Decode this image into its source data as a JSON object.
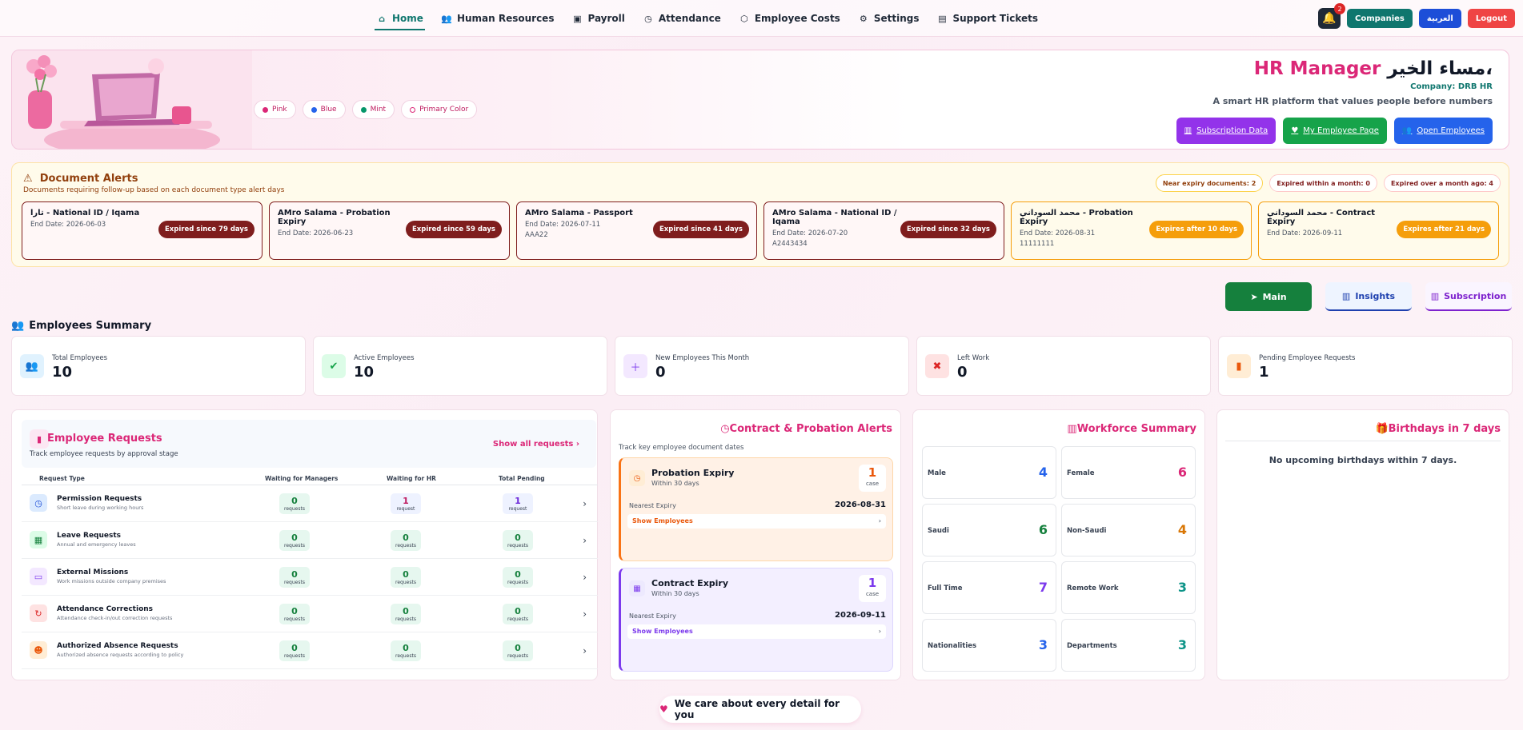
{
  "nav": {
    "items": [
      {
        "label": "Home",
        "icon": "home-icon"
      },
      {
        "label": "Human Resources",
        "icon": "people-icon"
      },
      {
        "label": "Payroll",
        "icon": "wallet-icon"
      },
      {
        "label": "Attendance",
        "icon": "clock-icon"
      },
      {
        "label": "Employee Costs",
        "icon": "box-icon"
      },
      {
        "label": "Settings",
        "icon": "gear-icon"
      },
      {
        "label": "Support Tickets",
        "icon": "ticket-icon"
      }
    ],
    "notification_count": "2",
    "companies": "Companies",
    "language": "العربية",
    "logout": "Logout"
  },
  "hero": {
    "greeting": "مساء الخير،",
    "role": "HR Manager",
    "company": "Company: DRB HR",
    "tagline": "A smart HR platform that values people before numbers",
    "themes": [
      {
        "label": "Pink",
        "color": "#db2777"
      },
      {
        "label": "Blue",
        "color": "#2563eb"
      },
      {
        "label": "Mint",
        "color": "#059669"
      },
      {
        "label": "Primary Color",
        "color": "#ffffff"
      }
    ],
    "buttons": {
      "subscription": "Subscription Data",
      "my_page": "My Employee Page",
      "open_employees": "Open Employees"
    }
  },
  "alerts": {
    "title": "Document Alerts",
    "subtitle": "Documents requiring follow-up based on each document type alert days",
    "pills": [
      "Near expiry documents: 2",
      "Expired within a month: 0",
      "Expired over a month ago: 4"
    ],
    "cards": [
      {
        "title": "تارا - National ID / Iqama",
        "end": "End Date: 2026-06-03",
        "extra": "",
        "badge": "Expired since 79 days",
        "warn": false
      },
      {
        "title": "AMro Salama - Probation Expiry",
        "end": "End Date: 2026-06-23",
        "extra": "",
        "badge": "Expired since 59 days",
        "warn": false
      },
      {
        "title": "AMro Salama - Passport",
        "end": "End Date: 2026-07-11",
        "extra": "AAA22",
        "badge": "Expired since 41 days",
        "warn": false
      },
      {
        "title": "AMro Salama - National ID / Iqama",
        "end": "End Date: 2026-07-20",
        "extra": "A2443434",
        "badge": "Expired since 32 days",
        "warn": false
      },
      {
        "title": "محمد السوداني - Probation Expiry",
        "end": "End Date: 2026-08-31",
        "extra": "11111111",
        "badge": "Expires after 10 days",
        "warn": true
      },
      {
        "title": "محمد السوداني - Contract Expiry",
        "end": "End Date: 2026-09-11",
        "extra": "",
        "badge": "Expires after 21 days",
        "warn": true
      }
    ]
  },
  "tabs": {
    "main": "Main",
    "insights": "Insights",
    "subscription": "Subscription"
  },
  "summary": {
    "title": "Employees Summary",
    "stats": [
      {
        "label": "Total Employees",
        "value": "10"
      },
      {
        "label": "Active Employees",
        "value": "10"
      },
      {
        "label": "New Employees This Month",
        "value": "0"
      },
      {
        "label": "Left Work",
        "value": "0"
      },
      {
        "label": "Pending Employee Requests",
        "value": "1"
      }
    ]
  },
  "requests": {
    "title": "Employee Requests",
    "subtitle": "Track employee requests by approval stage",
    "show_all": "Show all requests",
    "columns": [
      "Request Type",
      "Waiting for Managers",
      "Waiting for HR",
      "Total Pending"
    ],
    "rows": [
      {
        "name": "Permission Requests",
        "desc": "Short leave during working hours",
        "managers": "0",
        "managers_unit": "requests",
        "hr": "1",
        "hr_unit": "request",
        "total": "1",
        "total_unit": "request"
      },
      {
        "name": "Leave Requests",
        "desc": "Annual and emergency leaves",
        "managers": "0",
        "managers_unit": "requests",
        "hr": "0",
        "hr_unit": "requests",
        "total": "0",
        "total_unit": "requests"
      },
      {
        "name": "External Missions",
        "desc": "Work missions outside company premises",
        "managers": "0",
        "managers_unit": "requests",
        "hr": "0",
        "hr_unit": "requests",
        "total": "0",
        "total_unit": "requests"
      },
      {
        "name": "Attendance Corrections",
        "desc": "Attendance check-in/out correction requests",
        "managers": "0",
        "managers_unit": "requests",
        "hr": "0",
        "hr_unit": "requests",
        "total": "0",
        "total_unit": "requests"
      },
      {
        "name": "Authorized Absence Requests",
        "desc": "Authorized absence requests according to policy",
        "managers": "0",
        "managers_unit": "requests",
        "hr": "0",
        "hr_unit": "requests",
        "total": "0",
        "total_unit": "requests"
      }
    ]
  },
  "contract": {
    "title": "Contract & Probation Alerts",
    "subtitle": "Track key employee document dates",
    "boxes": [
      {
        "title": "Probation Expiry",
        "sub": "Within 30 days",
        "count": "1",
        "unit": "case",
        "nearest_label": "Nearest Expiry",
        "nearest": "2026-08-31",
        "show": "Show Employees"
      },
      {
        "title": "Contract Expiry",
        "sub": "Within 30 days",
        "count": "1",
        "unit": "case",
        "nearest_label": "Nearest Expiry",
        "nearest": "2026-09-11",
        "show": "Show Employees"
      }
    ]
  },
  "workforce": {
    "title": "Workforce Summary",
    "cells": [
      {
        "label": "Male",
        "value": "4",
        "color": "#2563eb"
      },
      {
        "label": "Female",
        "value": "6",
        "color": "#db2777"
      },
      {
        "label": "Saudi",
        "value": "6",
        "color": "#15803d"
      },
      {
        "label": "Non-Saudi",
        "value": "4",
        "color": "#d97706"
      },
      {
        "label": "Full Time",
        "value": "7",
        "color": "#7c3aed"
      },
      {
        "label": "Remote Work",
        "value": "3",
        "color": "#0d9488"
      },
      {
        "label": "Nationalities",
        "value": "3",
        "color": "#2563eb"
      },
      {
        "label": "Departments",
        "value": "3",
        "color": "#0d9488"
      }
    ]
  },
  "birthdays": {
    "title": "Birthdays in 7 days",
    "empty": "No upcoming birthdays within 7 days."
  },
  "footer": {
    "text": "We care about every detail for you"
  }
}
